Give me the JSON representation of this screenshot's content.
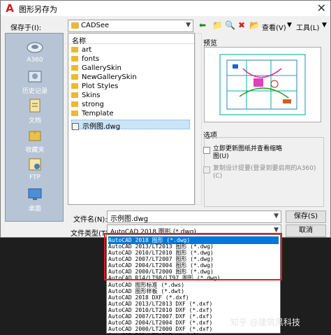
{
  "window": {
    "title": "图形另存为",
    "close_glyph": "✕"
  },
  "save_in": {
    "label": "保存于(I):",
    "value": "CADSee"
  },
  "toolbar": {
    "view_label": "查看(V)",
    "tools_label": "工具(L)"
  },
  "places": [
    {
      "label": "A360",
      "icon": "cloud-icon"
    },
    {
      "label": "历史记录",
      "icon": "history-icon"
    },
    {
      "label": "文档",
      "icon": "documents-icon"
    },
    {
      "label": "收藏夹",
      "icon": "favorites-icon"
    },
    {
      "label": "FTP",
      "icon": "ftp-icon"
    },
    {
      "label": "桌面",
      "icon": "desktop-icon"
    }
  ],
  "file_list": {
    "header": "名称",
    "items": [
      {
        "name": "art",
        "type": "folder"
      },
      {
        "name": "fonts",
        "type": "folder"
      },
      {
        "name": "GallerySkin",
        "type": "folder"
      },
      {
        "name": "NewGallerySkin",
        "type": "folder"
      },
      {
        "name": "Plot Styles",
        "type": "folder"
      },
      {
        "name": "Skins",
        "type": "folder"
      },
      {
        "name": "strong",
        "type": "folder"
      },
      {
        "name": "Template",
        "type": "folder"
      },
      {
        "name": "示例图.dwg",
        "type": "dwg"
      }
    ]
  },
  "preview": {
    "label": "预览"
  },
  "options": {
    "label": "选项",
    "update_thumb": "立即更新图纸并查看缩略图(U)",
    "copy_design": "复制设计提要(登录到要启用的A360)(C)"
  },
  "filename": {
    "label": "文件名(N):",
    "value": "示例图.dwg"
  },
  "filetype": {
    "label": "文件类型(T):",
    "value": "AutoCAD 2018 图形 (*.dwg)"
  },
  "buttons": {
    "save": "保存(S)",
    "cancel": "取消"
  },
  "filetype_options": [
    "AutoCAD 2018 图形 (*.dwg)",
    "AutoCAD 2013/LT2013 图形 (*.dwg)",
    "AutoCAD 2010/LT2010 图形 (*.dwg)",
    "AutoCAD 2007/LT2007 图形 (*.dwg)",
    "AutoCAD 2004/LT2004 图形 (*.dwg)",
    "AutoCAD 2000/LT2000 图形 (*.dwg)",
    "AutoCAD R14/LT98/LT97 图形 (*.dwg)",
    "AutoCAD 图形标准 (*.dws)",
    "AutoCAD 图形样板 (*.dwt)",
    "AutoCAD 2018 DXF (*.dxf)",
    "AutoCAD 2013/LT2013 DXF (*.dxf)",
    "AutoCAD 2010/LT2010 DXF (*.dxf)",
    "AutoCAD 2007/LT2007 DXF (*.dxf)",
    "AutoCAD 2004/LT2004 DXF (*.dxf)",
    "AutoCAD 2000/LT2000 DXF (*.dxf)",
    "AutoCAD R12/LT2 DXF (*.dxf)"
  ],
  "watermark": "知乎 @建筑黑科技",
  "colors": {
    "highlight": "#0078d7",
    "annotation": "#e01b24",
    "places_bg": "#b7c4d6"
  }
}
